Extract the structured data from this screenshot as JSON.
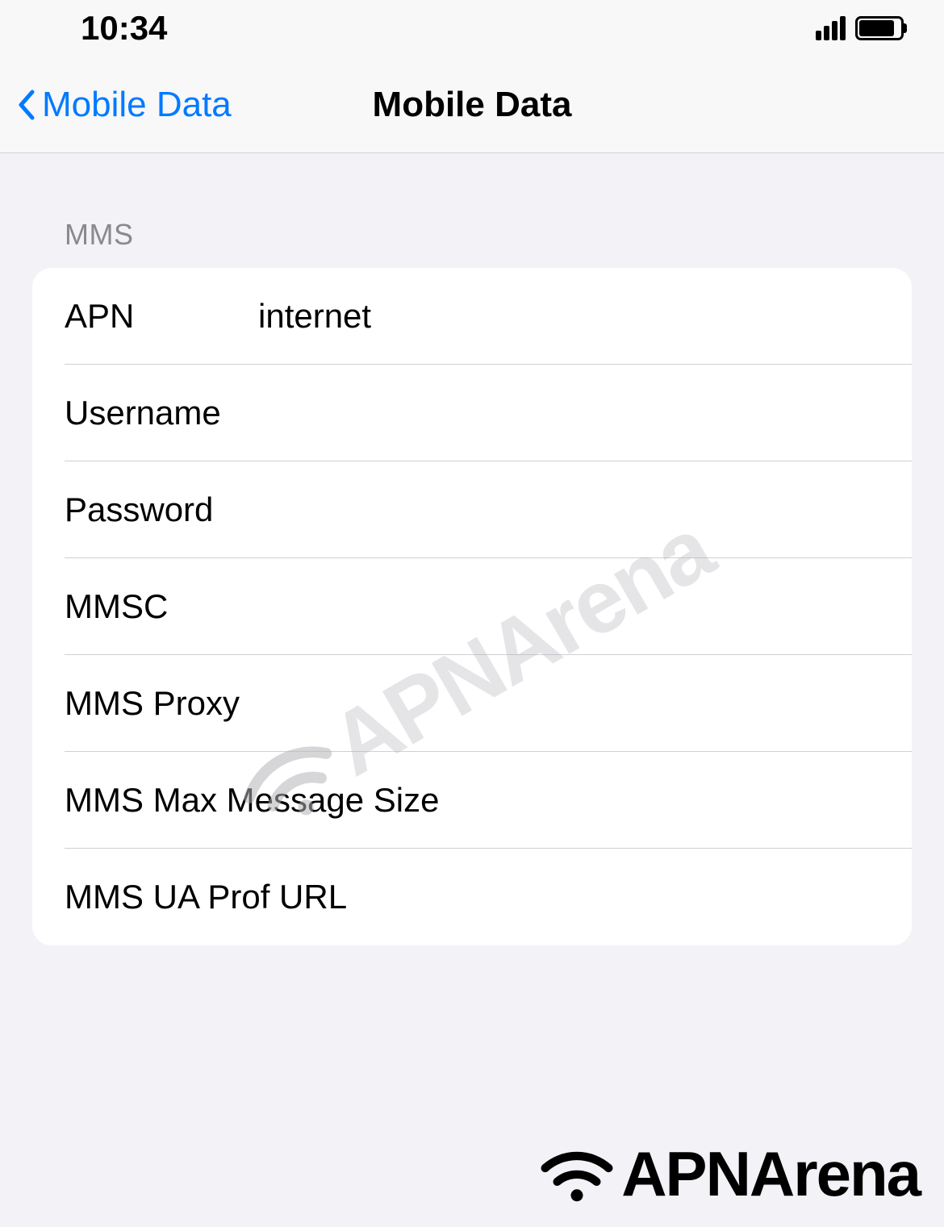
{
  "statusBar": {
    "time": "10:34"
  },
  "navBar": {
    "backLabel": "Mobile Data",
    "title": "Mobile Data"
  },
  "section": {
    "header": "MMS",
    "rows": {
      "apn": {
        "label": "APN",
        "value": "internet"
      },
      "username": {
        "label": "Username",
        "value": ""
      },
      "password": {
        "label": "Password",
        "value": ""
      },
      "mmsc": {
        "label": "MMSC",
        "value": ""
      },
      "mmsProxy": {
        "label": "MMS Proxy",
        "value": ""
      },
      "mmsMaxSize": {
        "label": "MMS Max Message Size",
        "value": ""
      },
      "mmsUaProf": {
        "label": "MMS UA Prof URL",
        "value": ""
      }
    }
  },
  "watermark": {
    "text": "APNArena"
  },
  "footer": {
    "text": "APNArena"
  }
}
